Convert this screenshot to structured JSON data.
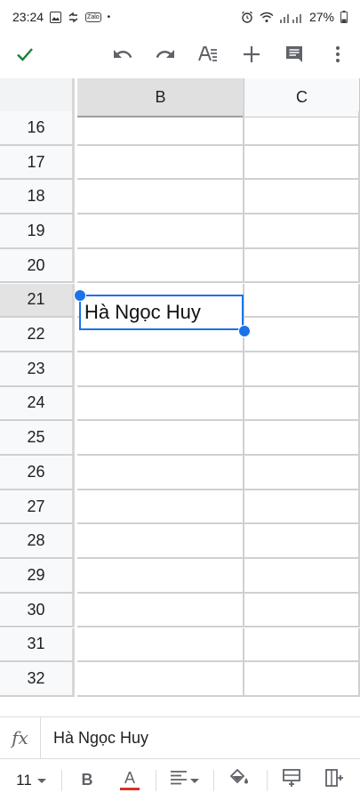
{
  "status_bar": {
    "time": "23:24",
    "notif_icons": [
      "image-icon",
      "sync-icon",
      "zalo-icon"
    ],
    "zalo_text": "Zalo",
    "dot": "•",
    "battery": "27%"
  },
  "toolbar": {
    "confirm_icon": "check-icon",
    "undo_icon": "undo-icon",
    "redo_icon": "redo-icon",
    "text_format_icon": "text-format-icon",
    "insert_icon": "plus-icon",
    "comment_icon": "comment-icon",
    "more_icon": "more-vert-icon"
  },
  "grid": {
    "columns": [
      "B",
      "C"
    ],
    "selected_column": "B",
    "rows": [
      "16",
      "17",
      "18",
      "19",
      "20",
      "21",
      "22",
      "23",
      "24",
      "25",
      "26",
      "27",
      "28",
      "29",
      "30",
      "31",
      "32"
    ],
    "selected_row": "21",
    "active_cell_value": "Hà Ngọc Huy"
  },
  "formula_bar": {
    "fx_label": "fx",
    "value": "Hà Ngọc Huy"
  },
  "format_bar": {
    "font_size": "11",
    "bold_label": "B",
    "text_color_label": "A",
    "text_color": "#d93025"
  }
}
